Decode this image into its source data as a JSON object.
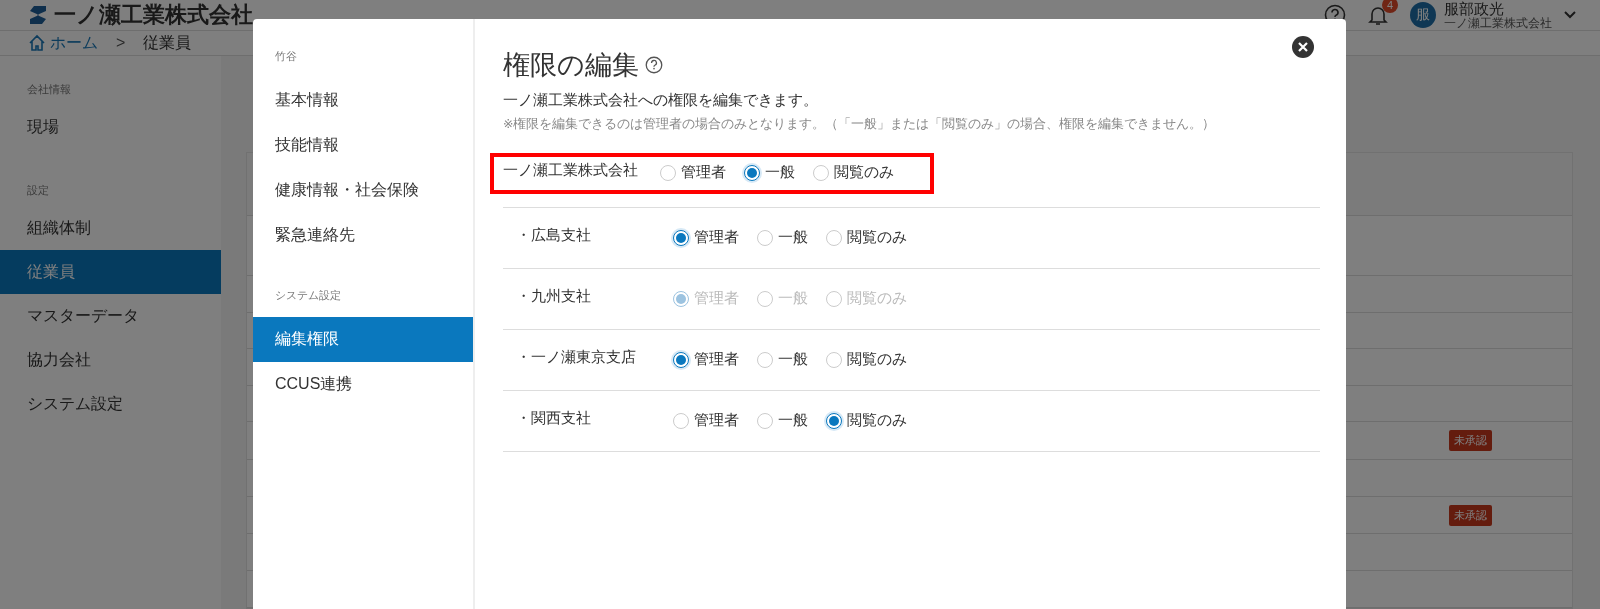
{
  "header": {
    "logo_text": "一ノ瀬工業株式会社",
    "notification_count": "4",
    "user": {
      "avatar": "服",
      "name": "服部政光",
      "company": "一ノ瀬工業株式会社"
    }
  },
  "breadcrumb": {
    "home": "ホーム",
    "separator": ">",
    "current": "従業員"
  },
  "sidebar": {
    "sections": [
      {
        "heading": "会社情報",
        "items": [
          {
            "label": "現場",
            "selected": false
          }
        ]
      },
      {
        "heading": "設定",
        "items": [
          {
            "label": "組織体制",
            "selected": false
          },
          {
            "label": "従業員",
            "selected": true
          },
          {
            "label": "マスターデータ",
            "selected": false
          },
          {
            "label": "協力会社",
            "selected": false
          },
          {
            "label": "システム設定",
            "selected": false
          }
        ]
      }
    ]
  },
  "table": {
    "rows": [
      {
        "kind": "header"
      },
      {
        "kind": "plain"
      },
      {
        "kind": "plain"
      },
      {
        "kind": "plain"
      },
      {
        "kind": "plain"
      },
      {
        "kind": "plain"
      },
      {
        "kind": "badge",
        "badge": "未承認"
      },
      {
        "kind": "plain"
      },
      {
        "kind": "badge",
        "badge": "未承認"
      },
      {
        "kind": "plain"
      },
      {
        "kind": "plain"
      }
    ]
  },
  "modal": {
    "employee_name": "竹谷",
    "nav": {
      "sections": [
        {
          "items": [
            {
              "label": "基本情報",
              "selected": false
            },
            {
              "label": "技能情報",
              "selected": false
            },
            {
              "label": "健康情報・社会保険",
              "selected": false
            },
            {
              "label": "緊急連絡先",
              "selected": false
            }
          ]
        },
        {
          "heading": "システム設定",
          "items": [
            {
              "label": "編集権限",
              "selected": true
            },
            {
              "label": "CCUS連携",
              "selected": false
            }
          ]
        }
      ]
    },
    "title": "権限の編集",
    "description": "一ノ瀬工業株式会社への権限を編集できます。",
    "note": "※権限を編集できるのは管理者の場合のみとなります。（「一般」または「閲覧のみ」の場合、権限を編集できません。）",
    "permissions": [
      {
        "name": "一ノ瀬工業株式会社",
        "highlighted": true,
        "disabled": false,
        "options": [
          {
            "label": "管理者",
            "selected": false
          },
          {
            "label": "一般",
            "selected": true
          },
          {
            "label": "閲覧のみ",
            "selected": false
          }
        ]
      },
      {
        "name": "・広島支社",
        "highlighted": false,
        "disabled": false,
        "options": [
          {
            "label": "管理者",
            "selected": true
          },
          {
            "label": "一般",
            "selected": false
          },
          {
            "label": "閲覧のみ",
            "selected": false
          }
        ]
      },
      {
        "name": "・九州支社",
        "highlighted": false,
        "disabled": true,
        "options": [
          {
            "label": "管理者",
            "selected": true
          },
          {
            "label": "一般",
            "selected": false
          },
          {
            "label": "閲覧のみ",
            "selected": false
          }
        ]
      },
      {
        "name": "・一ノ瀬東京支店",
        "highlighted": false,
        "disabled": false,
        "options": [
          {
            "label": "管理者",
            "selected": true
          },
          {
            "label": "一般",
            "selected": false
          },
          {
            "label": "閲覧のみ",
            "selected": false
          }
        ]
      },
      {
        "name": "・関西支社",
        "highlighted": false,
        "disabled": false,
        "options": [
          {
            "label": "管理者",
            "selected": false
          },
          {
            "label": "一般",
            "selected": false
          },
          {
            "label": "閲覧のみ",
            "selected": true
          }
        ]
      }
    ]
  }
}
